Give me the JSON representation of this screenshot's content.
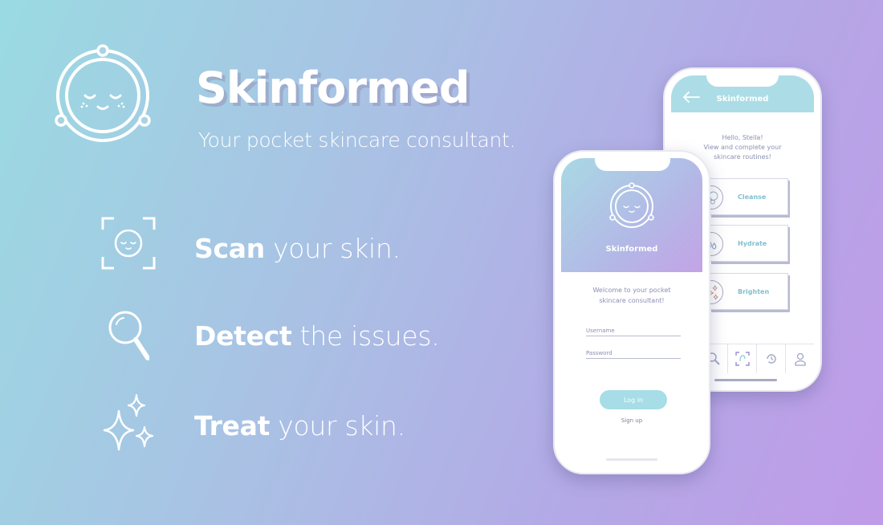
{
  "brand": {
    "name": "Skinformed",
    "tagline": "Your pocket skincare consultant."
  },
  "features": [
    {
      "bold": "Scan",
      "rest": " your skin.",
      "icon": "face-scan-icon"
    },
    {
      "bold": "Detect",
      "rest": " the issues.",
      "icon": "magnifier-icon"
    },
    {
      "bold": "Treat",
      "rest": " your skin.",
      "icon": "sparkles-icon"
    }
  ],
  "routines_screen": {
    "title": "Skinformed",
    "greeting_line1": "Hello, Stella!",
    "greeting_line2": "View and complete your",
    "greeting_line3": "skincare routines!",
    "routines": [
      {
        "label": "Cleanse",
        "icon": "bubbles-icon"
      },
      {
        "label": "Hydrate",
        "icon": "droplets-icon"
      },
      {
        "label": "Brighten",
        "icon": "sparkles-icon"
      }
    ],
    "tabs": [
      "search-icon",
      "scan-icon",
      "history-icon",
      "profile-icon"
    ]
  },
  "login_screen": {
    "brand": "Skinformed",
    "welcome_line1": "Welcome to your pocket",
    "welcome_line2": "skincare consultant!",
    "username_placeholder": "Username",
    "password_placeholder": "Password",
    "login_label": "Log in",
    "signup_label": "Sign up"
  },
  "colors": {
    "accent": "#a6dde6",
    "header": "#acdde6",
    "muted_text": "#8a8fb3"
  }
}
